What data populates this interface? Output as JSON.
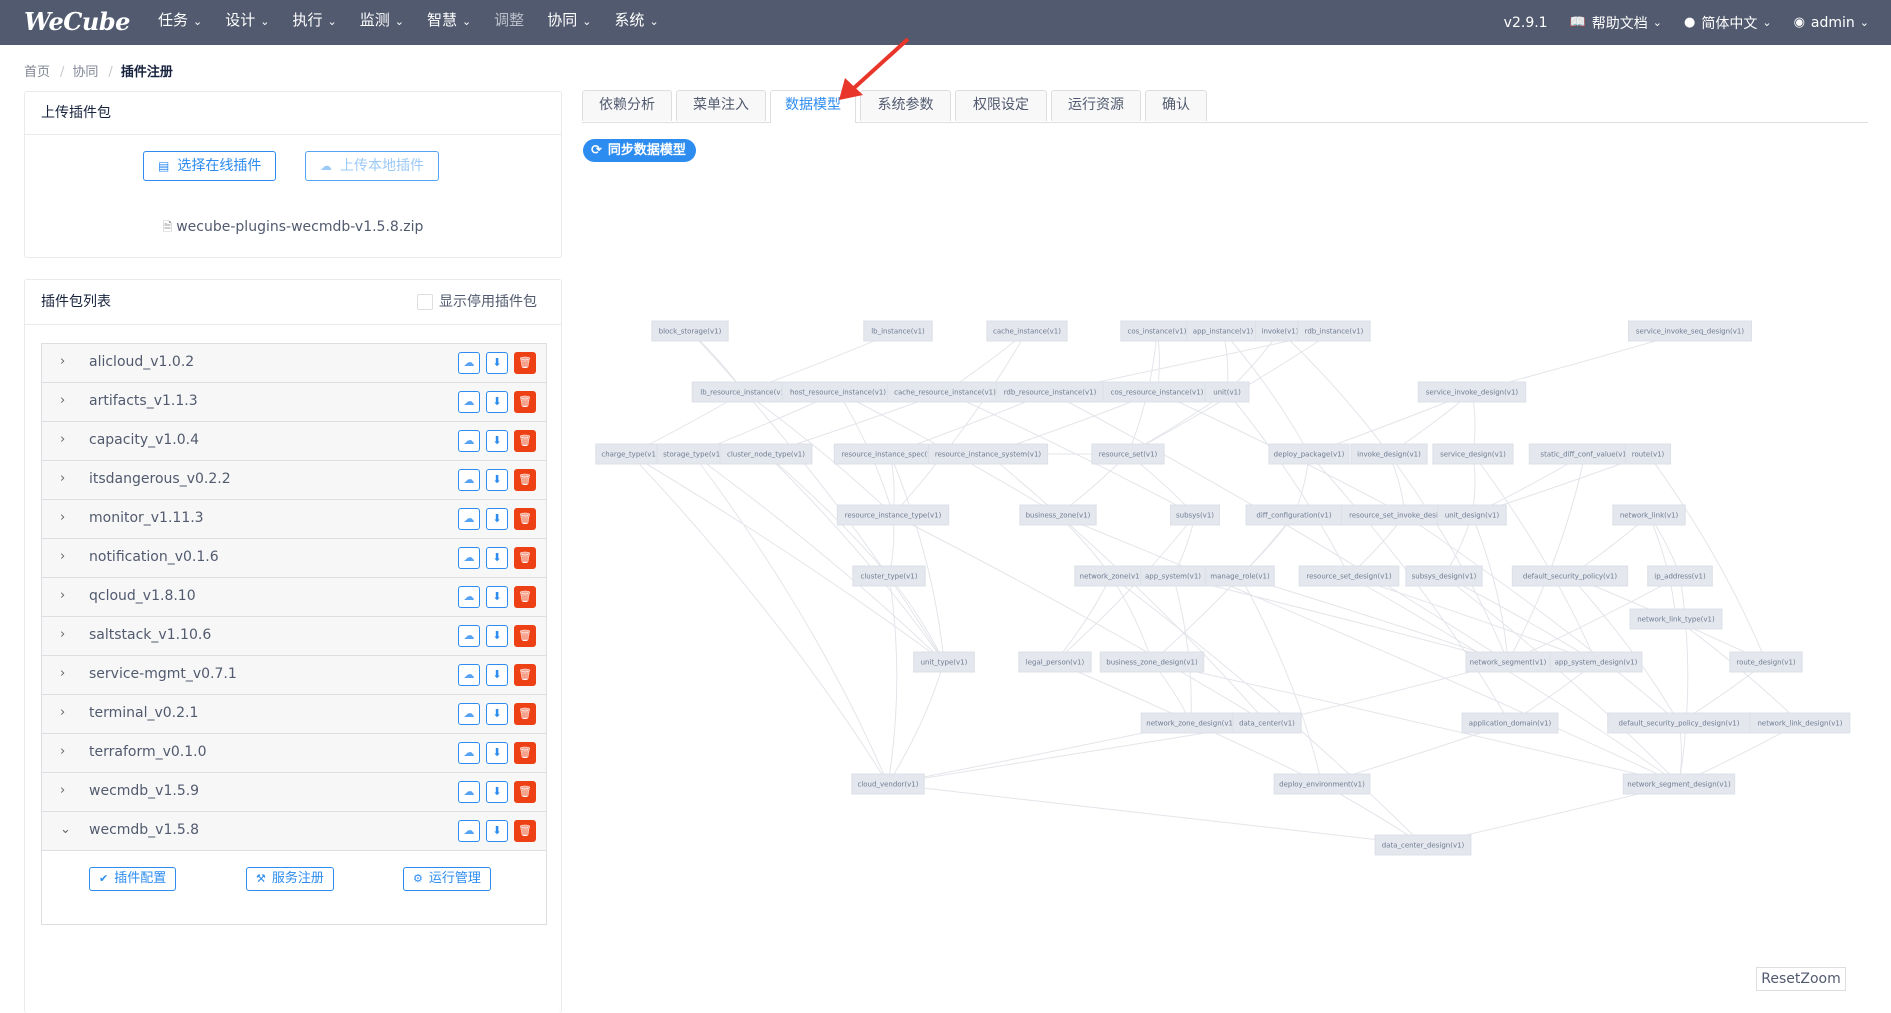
{
  "header": {
    "logo": "WeCube",
    "nav": [
      {
        "label": "任务",
        "dim": false
      },
      {
        "label": "设计",
        "dim": false
      },
      {
        "label": "执行",
        "dim": false
      },
      {
        "label": "监测",
        "dim": false
      },
      {
        "label": "智慧",
        "dim": false
      },
      {
        "label": "调整",
        "dim": true
      },
      {
        "label": "协同",
        "dim": false
      },
      {
        "label": "系统",
        "dim": false
      }
    ],
    "version": "v2.9.1",
    "help": "帮助文档",
    "language": "简体中文",
    "user": "admin"
  },
  "breadcrumb": {
    "home": "首页",
    "section": "协同",
    "current": "插件注册"
  },
  "upload_panel": {
    "title": "上传插件包",
    "select_online": "选择在线插件",
    "upload_local": "上传本地插件",
    "file_name": "wecube-plugins-wecmdb-v1.5.8.zip"
  },
  "list_panel": {
    "title": "插件包列表",
    "show_disabled": "显示停用插件包",
    "packages": [
      "alicloud_v1.0.2",
      "artifacts_v1.1.3",
      "capacity_v1.0.4",
      "itsdangerous_v0.2.2",
      "monitor_v1.11.3",
      "notification_v0.1.6",
      "qcloud_v1.8.10",
      "saltstack_v1.10.6",
      "service-mgmt_v0.7.1",
      "terminal_v0.2.1",
      "terraform_v0.1.0",
      "wecmdb_v1.5.9",
      "wecmdb_v1.5.8"
    ],
    "expanded_actions": {
      "config": "插件配置",
      "service": "服务注册",
      "runtime": "运行管理"
    }
  },
  "tabs": [
    "依赖分析",
    "菜单注入",
    "数据模型",
    "系统参数",
    "权限设定",
    "运行资源",
    "确认"
  ],
  "active_tab": "数据模型",
  "sync_button": "同步数据模型",
  "reset_zoom": "ResetZoom",
  "graph": {
    "nodes": [
      "block_storage(v1)",
      "lb_instance(v1)",
      "cache_instance(v1)",
      "cos_instance(v1)",
      "app_instance(v1)",
      "invoke(v1)",
      "rdb_instance(v1)",
      "service_invoke_seq_design(v1)",
      "lb_resource_instance(v1)",
      "host_resource_instance(v1)",
      "cache_resource_instance(v1)",
      "rdb_resource_instance(v1)",
      "cos_resource_instance(v1)",
      "unit(v1)",
      "service_invoke_design(v1)",
      "charge_type(v1)",
      "storage_type(v1)",
      "cluster_node_type(v1)",
      "resource_instance_spec(v1)",
      "resource_instance_system(v1)",
      "resource_set(v1)",
      "deploy_package(v1)",
      "invoke_design(v1)",
      "service_design(v1)",
      "static_diff_conf_value(v1)",
      "route(v1)",
      "resource_instance_type(v1)",
      "business_zone(v1)",
      "subsys(v1)",
      "diff_configuration(v1)",
      "resource_set_invoke_design(v1)",
      "unit_design(v1)",
      "network_link(v1)",
      "cluster_type(v1)",
      "network_zone(v1)",
      "app_system(v1)",
      "manage_role(v1)",
      "resource_set_design(v1)",
      "subsys_design(v1)",
      "default_security_policy(v1)",
      "ip_address(v1)",
      "network_link_type(v1)",
      "unit_type(v1)",
      "legal_person(v1)",
      "business_zone_design(v1)",
      "network_segment(v1)",
      "app_system_design(v1)",
      "route_design(v1)",
      "network_zone_design(v1)",
      "data_center(v1)",
      "application_domain(v1)",
      "default_security_policy_design(v1)",
      "network_link_design(v1)",
      "cloud_vendor(v1)",
      "deploy_environment(v1)",
      "network_segment_design(v1)",
      "data_center_design(v1)"
    ]
  }
}
